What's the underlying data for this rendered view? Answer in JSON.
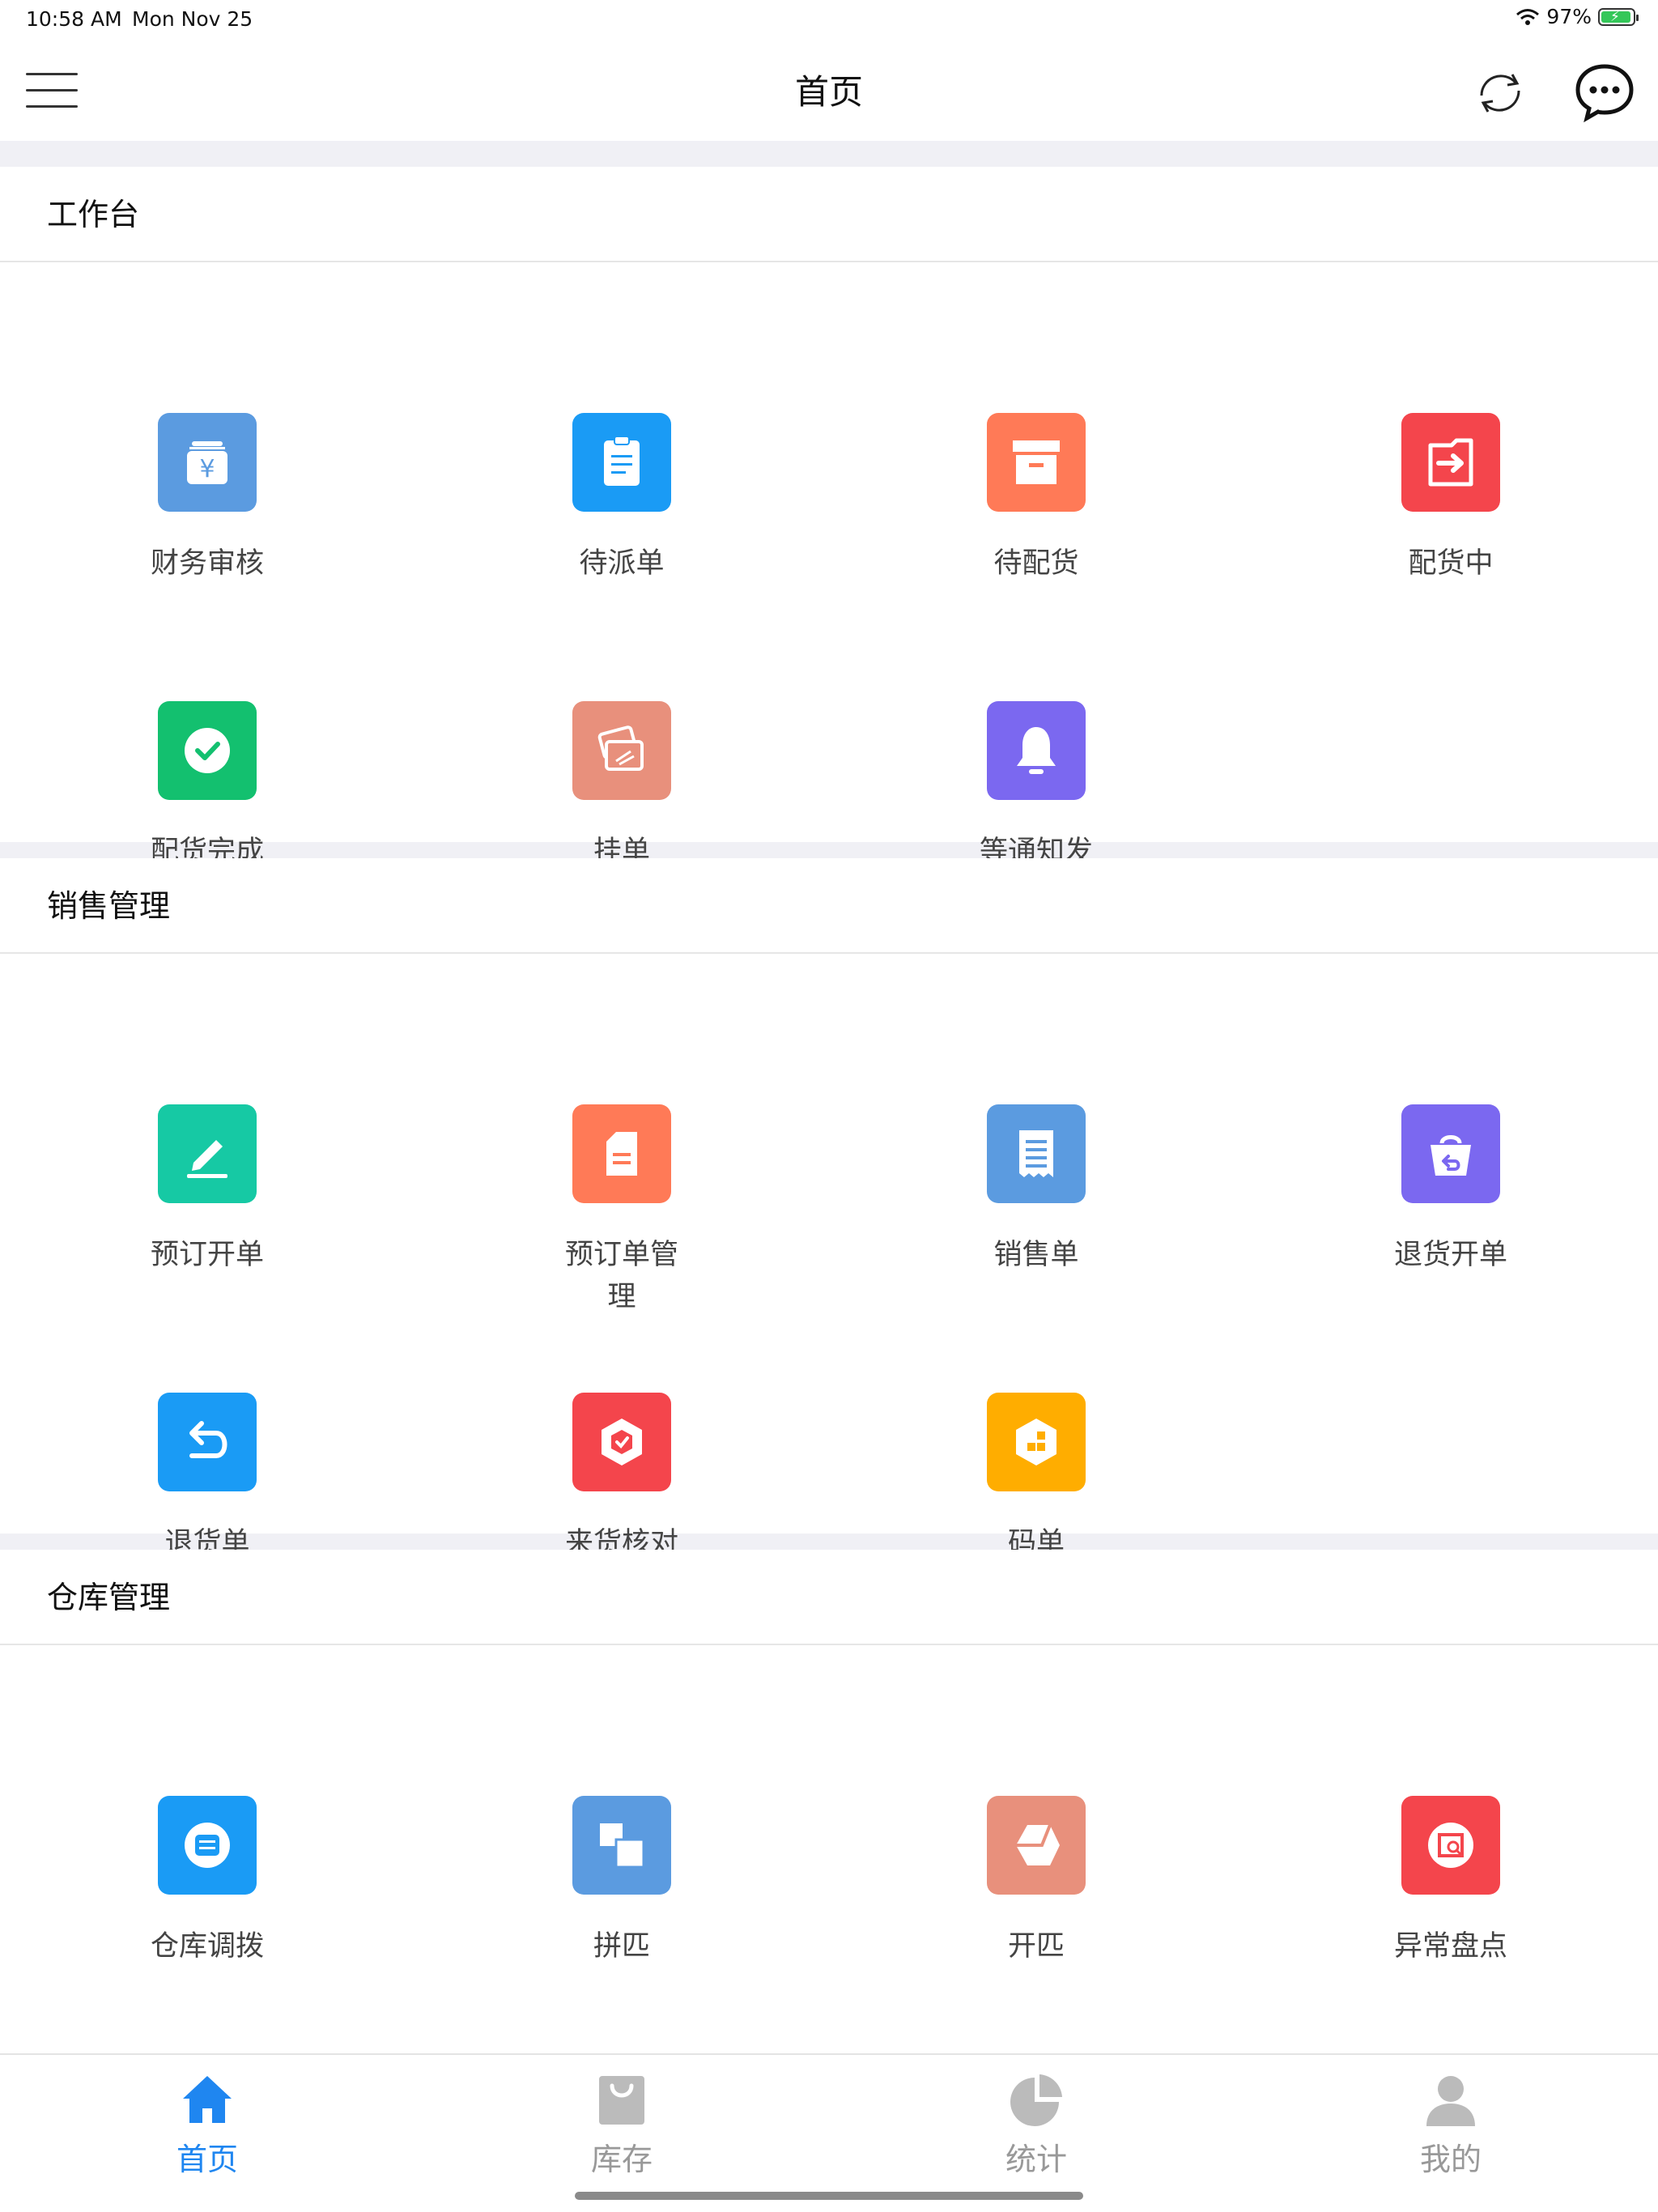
{
  "status_bar": {
    "time": "10:58 AM",
    "date": "Mon Nov 25",
    "battery": "97%"
  },
  "header": {
    "title": "首页"
  },
  "sections": [
    {
      "title": "工作台",
      "items": [
        {
          "label": "财务审核",
          "icon": "finance-review-icon",
          "color": "#5b9be0"
        },
        {
          "label": "待派单",
          "icon": "clipboard-icon",
          "color": "#1a9bf5"
        },
        {
          "label": "待配货",
          "icon": "archive-box-icon",
          "color": "#ff7a57"
        },
        {
          "label": "配货中",
          "icon": "arrow-right-box-icon",
          "color": "#f4454c"
        },
        {
          "label": "配货完成",
          "icon": "check-circle-icon",
          "color": "#13c06f"
        },
        {
          "label": "挂单",
          "icon": "cards-icon",
          "color": "#e8907c"
        },
        {
          "label": "等通知发货",
          "icon": "bell-icon",
          "color": "#7b68f0"
        }
      ]
    },
    {
      "title": "销售管理",
      "items": [
        {
          "label": "预订开单",
          "icon": "pen-icon",
          "color": "#16c9a4"
        },
        {
          "label": "预订单管理",
          "icon": "document-icon",
          "color": "#ff7a57"
        },
        {
          "label": "销售单",
          "icon": "receipt-icon",
          "color": "#5b9be0"
        },
        {
          "label": "退货开单",
          "icon": "return-bag-icon",
          "color": "#7b68f0"
        },
        {
          "label": "退货单",
          "icon": "undo-arrow-icon",
          "color": "#1a9bf5"
        },
        {
          "label": "来货核对",
          "icon": "shield-check-icon",
          "color": "#f4454c"
        },
        {
          "label": "码单",
          "icon": "cube-blocks-icon",
          "color": "#ffad00"
        }
      ]
    },
    {
      "title": "仓库管理",
      "items": [
        {
          "label": "仓库调拨",
          "icon": "warehouse-icon",
          "color": "#1a9bf5"
        },
        {
          "label": "拼匹",
          "icon": "merge-squares-icon",
          "color": "#5b9be0"
        },
        {
          "label": "开匹",
          "icon": "split-shape-icon",
          "color": "#e8907c"
        },
        {
          "label": "异常盘点",
          "icon": "inventory-search-icon",
          "color": "#f4454c"
        },
        {
          "label": "",
          "icon": "box-search-icon",
          "color": "#13c06f"
        },
        {
          "label": "",
          "icon": "house-chart-icon",
          "color": "#7b68f0"
        }
      ]
    }
  ],
  "tabs": [
    {
      "label": "首页",
      "icon": "home-icon",
      "active": true
    },
    {
      "label": "库存",
      "icon": "bag-icon",
      "active": false
    },
    {
      "label": "统计",
      "icon": "pie-chart-icon",
      "active": false
    },
    {
      "label": "我的",
      "icon": "user-icon",
      "active": false
    }
  ],
  "colors": {
    "accent": "#1f86f0",
    "inactive": "#bbbbbb"
  }
}
